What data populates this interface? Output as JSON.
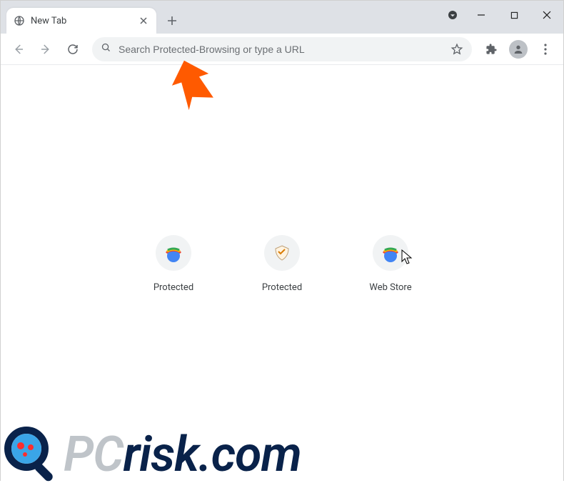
{
  "window": {
    "minimize": "–",
    "maximize": "☐",
    "close": "✕"
  },
  "tabs": [
    {
      "title": "New Tab"
    }
  ],
  "toolbar": {
    "omnibox_placeholder": "Search Protected-Browsing or type a URL"
  },
  "shortcuts": [
    {
      "label": "Protected",
      "icon": "chrome-rainbow"
    },
    {
      "label": "Protected",
      "icon": "shield-sketch"
    },
    {
      "label": "Web Store",
      "icon": "chrome-rainbow"
    }
  ],
  "watermark": {
    "text_prefix": "PC",
    "text_suffix": "risk.com"
  },
  "colors": {
    "arrow": "#ff5a00",
    "tabstrip": "#dee1e6",
    "omnibox_bg": "#f1f3f4"
  }
}
